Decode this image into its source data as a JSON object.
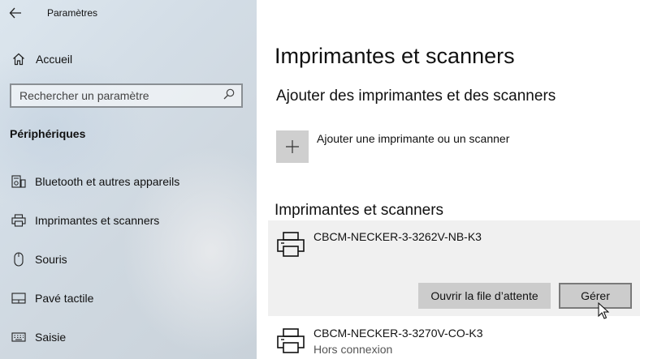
{
  "window": {
    "back_icon": "arrow-left-icon",
    "app_title": "Paramètres"
  },
  "sidebar": {
    "home": {
      "icon": "home-icon",
      "label": "Accueil"
    },
    "search": {
      "placeholder": "Rechercher un paramètre",
      "value": "",
      "icon": "search-icon"
    },
    "section_title": "Périphériques",
    "items": [
      {
        "icon": "keyboard-speaker-icon",
        "label": "Bluetooth et autres appareils"
      },
      {
        "icon": "printer-icon",
        "label": "Imprimantes et scanners"
      },
      {
        "icon": "mouse-icon",
        "label": "Souris"
      },
      {
        "icon": "touchpad-icon",
        "label": "Pavé tactile"
      },
      {
        "icon": "keyboard-icon",
        "label": "Saisie"
      }
    ]
  },
  "main": {
    "title": "Imprimantes et scanners",
    "add_section_heading": "Ajouter des imprimantes et des scanners",
    "add_button": {
      "icon": "plus-icon",
      "label": "Ajouter une imprimante ou un scanner"
    },
    "printers_heading": "Imprimantes et scanners",
    "printers": [
      {
        "icon": "printer-icon",
        "name": "CBCM-NECKER-3-3262V-NB-K3",
        "status": "",
        "selected": true
      },
      {
        "icon": "printer-icon",
        "name": "CBCM-NECKER-3-3270V-CO-K3",
        "status": "Hors connexion",
        "selected": false
      }
    ],
    "actions": {
      "open_queue_label": "Ouvrir la file d’attente",
      "manage_label": "Gérer"
    }
  },
  "colors": {
    "sidebar_bg": "#d3dde6",
    "selected_card_bg": "#f0f0f0",
    "button_bg": "#cccccc",
    "add_tile_bg": "#cfcfcf"
  }
}
